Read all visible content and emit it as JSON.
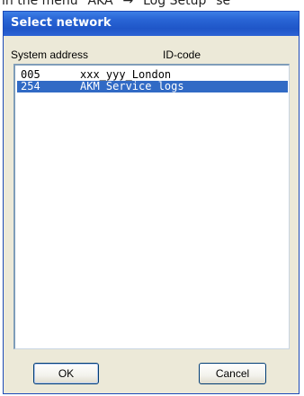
{
  "background_text": "in the menu \"AKA\" → \"Log Setup\" se",
  "dialog": {
    "title": "Select network",
    "columns": {
      "address": "System address",
      "id": "ID-code"
    },
    "rows": [
      {
        "address": "005",
        "id": "xxx_yyy_London",
        "selected": false
      },
      {
        "address": "254",
        "id": "AKM Service logs",
        "selected": true
      }
    ],
    "buttons": {
      "ok": "OK",
      "cancel": "Cancel"
    }
  },
  "colors": {
    "titlebar": "#1f56c8",
    "selection": "#316ac5",
    "dialog_bg": "#ece9d8"
  }
}
